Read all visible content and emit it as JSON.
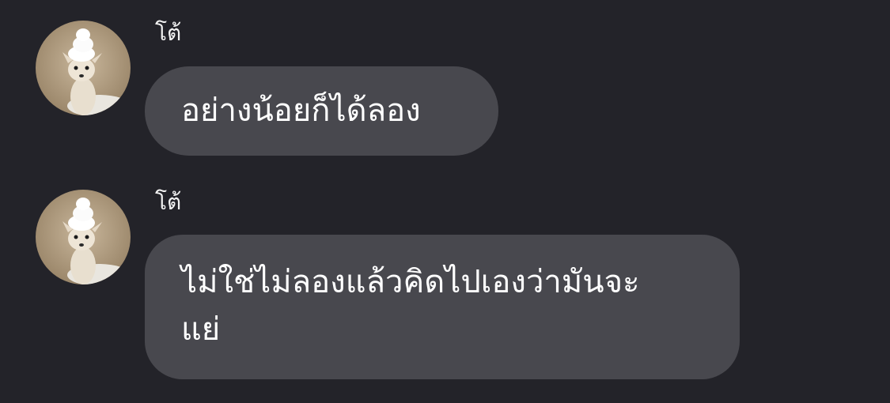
{
  "messages": [
    {
      "sender": "โต้",
      "avatar_icon": "chihuahua-avatar",
      "text": "อย่างน้อยก็ได้ลอง"
    },
    {
      "sender": "โต้",
      "avatar_icon": "chihuahua-avatar",
      "text": "ไม่ใช่ไม่ลองแล้วคิดไปเองว่ามันจะ\nแย่"
    }
  ],
  "colors": {
    "background": "#232329",
    "bubble": "#48484e",
    "text": "#ffffff"
  }
}
